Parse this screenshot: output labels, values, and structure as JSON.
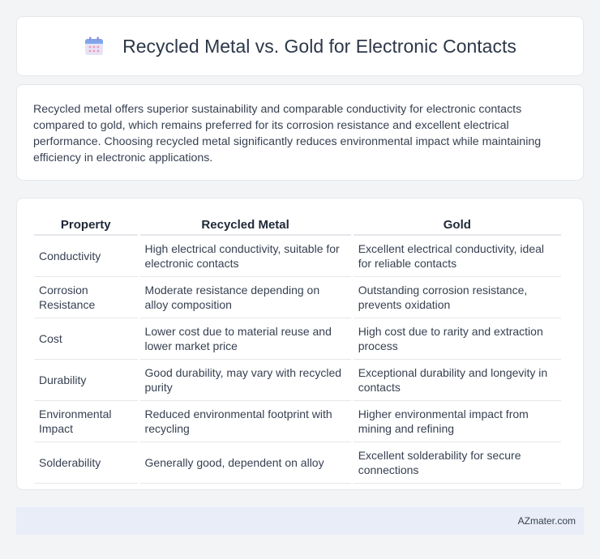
{
  "header": {
    "icon": "calendar-icon",
    "title": "Recycled Metal vs. Gold for Electronic Contacts"
  },
  "intro": {
    "text": "Recycled metal offers superior sustainability and comparable conductivity for electronic contacts compared to gold, which remains preferred for its corrosion resistance and excellent electrical performance. Choosing recycled metal significantly reduces environmental impact while maintaining efficiency in electronic applications."
  },
  "table": {
    "headers": [
      "Property",
      "Recycled Metal",
      "Gold"
    ],
    "rows": [
      [
        "Conductivity",
        "High electrical conductivity, suitable for electronic contacts",
        "Excellent electrical conductivity, ideal for reliable contacts"
      ],
      [
        "Corrosion Resistance",
        "Moderate resistance depending on alloy composition",
        "Outstanding corrosion resistance, prevents oxidation"
      ],
      [
        "Cost",
        "Lower cost due to material reuse and lower market price",
        "High cost due to rarity and extraction process"
      ],
      [
        "Durability",
        "Good durability, may vary with recycled purity",
        "Exceptional durability and longevity in contacts"
      ],
      [
        "Environmental Impact",
        "Reduced environmental footprint with recycling",
        "Higher environmental impact from mining and refining"
      ],
      [
        "Solderability",
        "Generally good, dependent on alloy",
        "Excellent solderability for secure connections"
      ]
    ]
  },
  "footer": {
    "text": "AZmater.com"
  },
  "colors": {
    "page_background": "#f3f4f6",
    "card_background": "#ffffff",
    "footer_background": "#e8edf7",
    "border": "#e5e7eb"
  }
}
